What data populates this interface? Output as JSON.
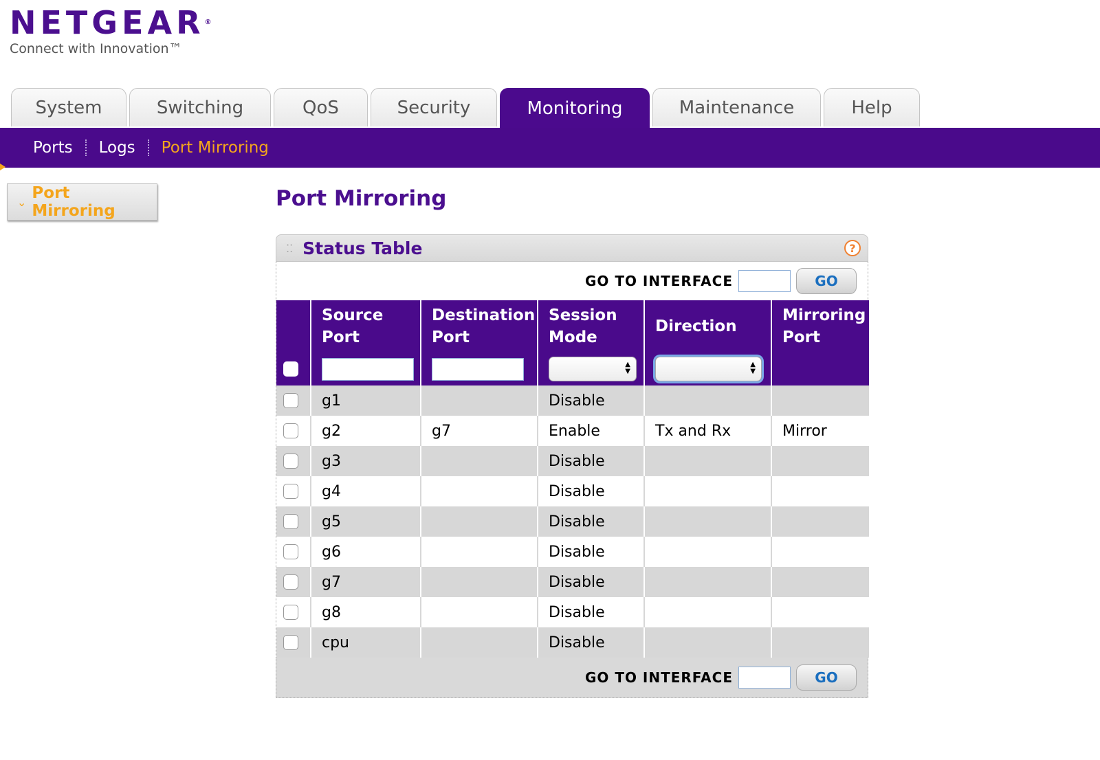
{
  "logo": {
    "brand": "NETGEAR",
    "reg": "®",
    "tagline": "Connect with Innovation™"
  },
  "tabs": [
    "System",
    "Switching",
    "QoS",
    "Security",
    "Monitoring",
    "Maintenance",
    "Help"
  ],
  "active_tab": "Monitoring",
  "subnav": {
    "items": [
      "Ports",
      "Logs",
      "Port Mirroring"
    ],
    "active": "Port Mirroring"
  },
  "sidebar": {
    "item": "Port Mirroring"
  },
  "page": {
    "title": "Port Mirroring"
  },
  "panel": {
    "title": "Status Table",
    "goto_label": "GO TO INTERFACE",
    "go_button": "GO",
    "help": "?"
  },
  "table": {
    "headers": {
      "source_port": [
        "Source",
        "Port"
      ],
      "destination_port": [
        "Destination",
        "Port"
      ],
      "session_mode": [
        "Session",
        "Mode"
      ],
      "direction": "Direction",
      "mirroring_port": [
        "Mirroring",
        "Port"
      ]
    },
    "rows": [
      {
        "source": "g1",
        "destination": "",
        "mode": "Disable",
        "direction": "",
        "mirroring": ""
      },
      {
        "source": "g2",
        "destination": "g7",
        "mode": "Enable",
        "direction": "Tx and Rx",
        "mirroring": "Mirror"
      },
      {
        "source": "g3",
        "destination": "",
        "mode": "Disable",
        "direction": "",
        "mirroring": ""
      },
      {
        "source": "g4",
        "destination": "",
        "mode": "Disable",
        "direction": "",
        "mirroring": ""
      },
      {
        "source": "g5",
        "destination": "",
        "mode": "Disable",
        "direction": "",
        "mirroring": ""
      },
      {
        "source": "g6",
        "destination": "",
        "mode": "Disable",
        "direction": "",
        "mirroring": ""
      },
      {
        "source": "g7",
        "destination": "",
        "mode": "Disable",
        "direction": "",
        "mirroring": ""
      },
      {
        "source": "g8",
        "destination": "",
        "mode": "Disable",
        "direction": "",
        "mirroring": ""
      },
      {
        "source": "cpu",
        "destination": "",
        "mode": "Disable",
        "direction": "",
        "mirroring": ""
      }
    ]
  },
  "colors": {
    "brand_purple": "#4a0a8b",
    "accent_orange": "#f4a51c",
    "link_blue": "#1b6fbf"
  }
}
